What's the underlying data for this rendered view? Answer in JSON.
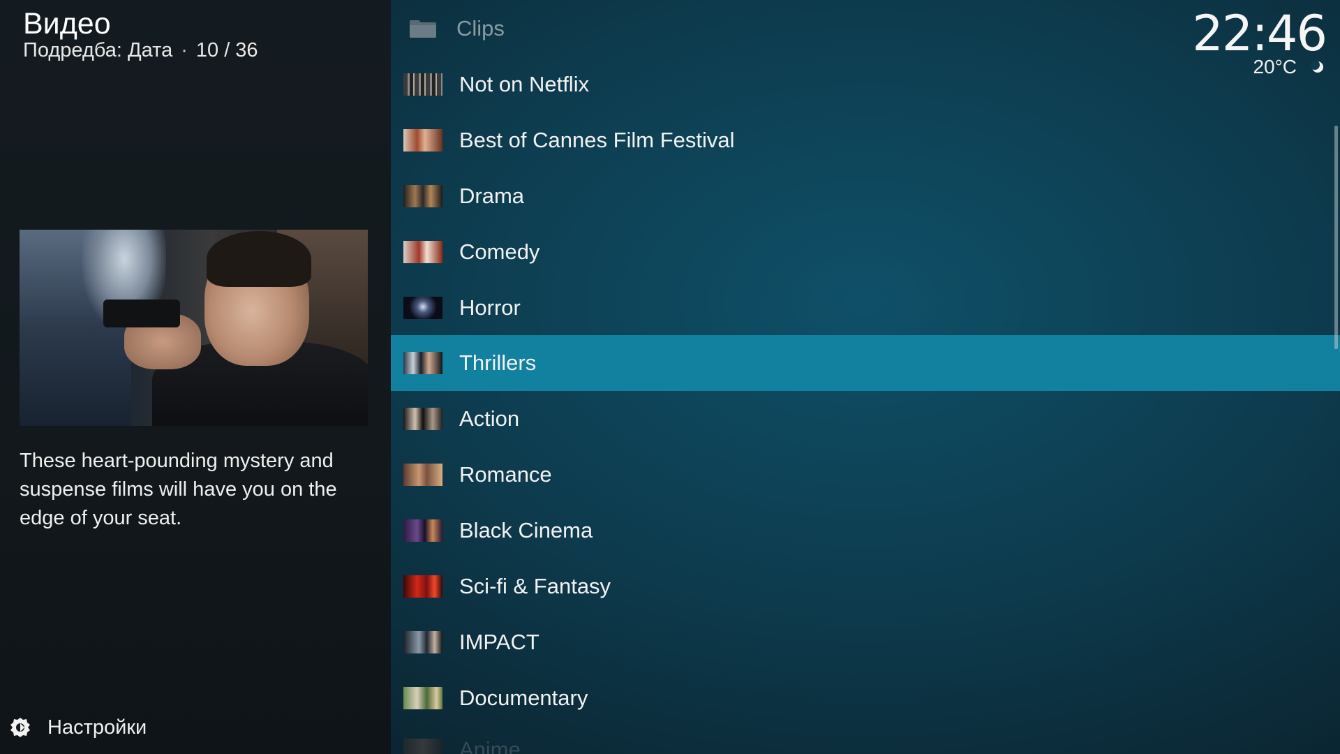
{
  "header": {
    "title": "Видео",
    "sort_label": "Подредба: Дата",
    "separator": "·",
    "position": "10 / 36"
  },
  "clock": {
    "time": "22:46",
    "temperature": "20°C",
    "weather_icon": "moon-icon"
  },
  "info": {
    "fanart_icon": "movie-still-image",
    "plot": "These heart-pounding mystery and suspense films will have you on the edge of your seat."
  },
  "footer": {
    "settings_label": "Настройки",
    "settings_icon": "gear-icon"
  },
  "list": {
    "selected_index": 6,
    "items": [
      {
        "label": "Clips",
        "icon": "folder-icon"
      },
      {
        "label": "Not on Netflix",
        "icon": "collection-thumbnail"
      },
      {
        "label": "Best of Cannes Film Festival",
        "icon": "collection-thumbnail"
      },
      {
        "label": "Drama",
        "icon": "collection-thumbnail"
      },
      {
        "label": "Comedy",
        "icon": "collection-thumbnail"
      },
      {
        "label": "Horror",
        "icon": "collection-thumbnail"
      },
      {
        "label": "Thrillers",
        "icon": "collection-thumbnail"
      },
      {
        "label": "Action",
        "icon": "collection-thumbnail"
      },
      {
        "label": "Romance",
        "icon": "collection-thumbnail"
      },
      {
        "label": "Black Cinema",
        "icon": "collection-thumbnail"
      },
      {
        "label": "Sci-fi & Fantasy",
        "icon": "collection-thumbnail"
      },
      {
        "label": "IMPACT",
        "icon": "collection-thumbnail"
      },
      {
        "label": "Documentary",
        "icon": "collection-thumbnail"
      },
      {
        "label": "Anime",
        "icon": "collection-thumbnail"
      }
    ]
  },
  "colors": {
    "selected_row": "#12809f",
    "list_background": "#0d3a4c",
    "left_panel_background": "#141b20"
  }
}
